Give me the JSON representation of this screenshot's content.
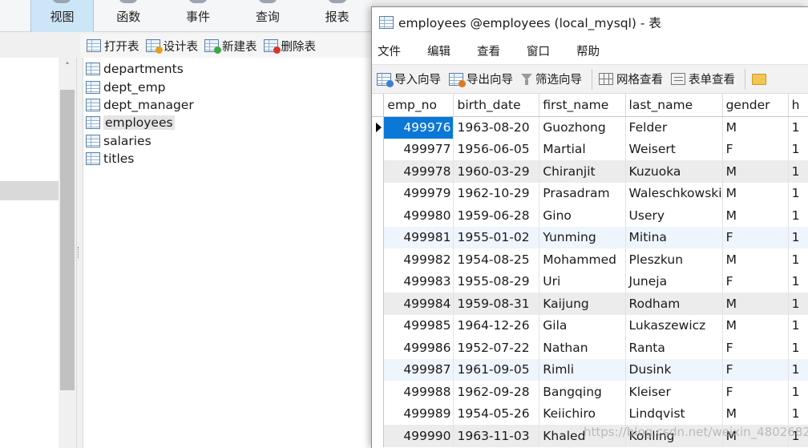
{
  "ribbon": {
    "tabs": [
      {
        "label": "视图",
        "active": true
      },
      {
        "label": "函数",
        "active": false
      },
      {
        "label": "事件",
        "active": false
      },
      {
        "label": "查询",
        "active": false
      },
      {
        "label": "报表",
        "active": false
      }
    ]
  },
  "object_toolbar": {
    "open_table": "打开表",
    "design_table": "设计表",
    "new_table": "新建表",
    "delete_table": "删除表"
  },
  "table_list": {
    "items": [
      {
        "label": "departments",
        "selected": false
      },
      {
        "label": "dept_emp",
        "selected": false
      },
      {
        "label": "dept_manager",
        "selected": false
      },
      {
        "label": "employees",
        "selected": true
      },
      {
        "label": "salaries",
        "selected": false
      },
      {
        "label": "titles",
        "selected": false
      }
    ]
  },
  "table_window": {
    "title": "employees @employees (local_mysql) - 表",
    "menu": [
      "文件",
      "编辑",
      "查看",
      "窗口",
      "帮助"
    ],
    "toolbar": {
      "import_wizard": "导入向导",
      "export_wizard": "导出向导",
      "filter_wizard": "筛选向导",
      "grid_view": "网格查看",
      "form_view": "表单查看"
    },
    "columns": [
      "emp_no",
      "birth_date",
      "first_name",
      "last_name",
      "gender",
      "h"
    ],
    "rows": [
      {
        "emp_no": "499976",
        "birth_date": "1963-08-20",
        "first_name": "Guozhong",
        "last_name": "Felder",
        "gender": "M",
        "h": "1"
      },
      {
        "emp_no": "499977",
        "birth_date": "1956-06-05",
        "first_name": "Martial",
        "last_name": "Weisert",
        "gender": "F",
        "h": "1"
      },
      {
        "emp_no": "499978",
        "birth_date": "1960-03-29",
        "first_name": "Chiranjit",
        "last_name": "Kuzuoka",
        "gender": "M",
        "h": "1"
      },
      {
        "emp_no": "499979",
        "birth_date": "1962-10-29",
        "first_name": "Prasadram",
        "last_name": "Waleschkowski",
        "gender": "M",
        "h": "1"
      },
      {
        "emp_no": "499980",
        "birth_date": "1959-06-28",
        "first_name": "Gino",
        "last_name": "Usery",
        "gender": "M",
        "h": "1"
      },
      {
        "emp_no": "499981",
        "birth_date": "1955-01-02",
        "first_name": "Yunming",
        "last_name": "Mitina",
        "gender": "F",
        "h": "1"
      },
      {
        "emp_no": "499982",
        "birth_date": "1954-08-25",
        "first_name": "Mohammed",
        "last_name": "Pleszkun",
        "gender": "M",
        "h": "1"
      },
      {
        "emp_no": "499983",
        "birth_date": "1955-08-29",
        "first_name": "Uri",
        "last_name": "Juneja",
        "gender": "F",
        "h": "1"
      },
      {
        "emp_no": "499984",
        "birth_date": "1959-08-31",
        "first_name": "Kaijung",
        "last_name": "Rodham",
        "gender": "M",
        "h": "1"
      },
      {
        "emp_no": "499985",
        "birth_date": "1964-12-26",
        "first_name": "Gila",
        "last_name": "Lukaszewicz",
        "gender": "M",
        "h": "1"
      },
      {
        "emp_no": "499986",
        "birth_date": "1952-07-22",
        "first_name": "Nathan",
        "last_name": "Ranta",
        "gender": "F",
        "h": "1"
      },
      {
        "emp_no": "499987",
        "birth_date": "1961-09-05",
        "first_name": "Rimli",
        "last_name": "Dusink",
        "gender": "F",
        "h": "1"
      },
      {
        "emp_no": "499988",
        "birth_date": "1962-09-28",
        "first_name": "Bangqing",
        "last_name": "Kleiser",
        "gender": "F",
        "h": "1"
      },
      {
        "emp_no": "499989",
        "birth_date": "1954-05-26",
        "first_name": "Keiichiro",
        "last_name": "Lindqvist",
        "gender": "M",
        "h": "1"
      },
      {
        "emp_no": "499990",
        "birth_date": "1963-11-03",
        "first_name": "Khaled",
        "last_name": "Kohling",
        "gender": "M",
        "h": "1"
      }
    ]
  },
  "watermark": "https://blog.csdn.net/weixin_48026822",
  "colors": {
    "selection": "#0a78d7",
    "active_tab": "#cde6f7",
    "alt_row": "#ececec",
    "soft_row": "#eef5fc"
  }
}
